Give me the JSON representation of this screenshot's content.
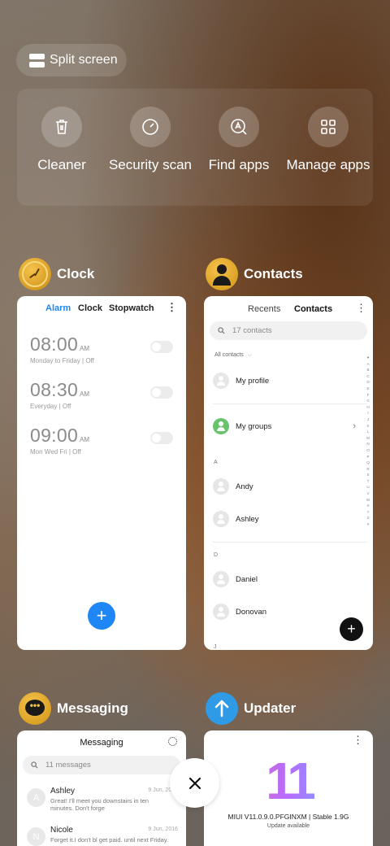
{
  "split_screen": {
    "label": "Split screen"
  },
  "tools": [
    {
      "label": "Cleaner",
      "icon": "trash-icon"
    },
    {
      "label": "Security scan",
      "icon": "speedometer-icon"
    },
    {
      "label": "Find apps",
      "icon": "find-apps-icon"
    },
    {
      "label": "Manage apps",
      "icon": "grid-icon"
    }
  ],
  "apps": {
    "clock": {
      "title": "Clock",
      "tabs": [
        "Alarm",
        "Clock",
        "Stopwatch"
      ],
      "alarms": [
        {
          "time": "08:00",
          "ampm": "AM",
          "sub": "Monday to Friday  |  Off"
        },
        {
          "time": "08:30",
          "ampm": "AM",
          "sub": "Everyday  |  Off"
        },
        {
          "time": "09:00",
          "ampm": "AM",
          "sub": "Mon Wed Fri  |  Off"
        }
      ],
      "fab": "+"
    },
    "contacts": {
      "title": "Contacts",
      "tabs": [
        "Recents",
        "Contacts"
      ],
      "search_placeholder": "17 contacts",
      "filter": "All contacts",
      "my_profile": "My profile",
      "my_groups": "My groups",
      "section_a": "A",
      "section_d": "D",
      "section_next": "J",
      "contacts": [
        "Andy",
        "Ashley",
        "Daniel",
        "Donovan"
      ],
      "index": "♥ A B C D E F G H I J K L M N O P Q R S T U V W X Y Z #",
      "fab": "+"
    },
    "messaging": {
      "title": "Messaging",
      "header": "Messaging",
      "search_placeholder": "11 messages",
      "threads": [
        {
          "initial": "A",
          "name": "Ashley",
          "date": "9 Jun, 2016",
          "text": "Great! I'll meet you downstairs in ten minutes. Don't forge"
        },
        {
          "initial": "N",
          "name": "Nicole",
          "date": "9 Jun, 2016",
          "text": "Forget it.I don't bl get paid. until next Friday."
        }
      ]
    },
    "updater": {
      "title": "Updater",
      "logo_text": "11",
      "version": "MIUI V11.0.9.0.PFGINXM | Stable 1.9G",
      "status": "Update available"
    }
  },
  "close": {
    "icon": "close-icon"
  },
  "colors": {
    "accent_blue": "#1f86f5",
    "updater_blue": "#2f9be6"
  }
}
